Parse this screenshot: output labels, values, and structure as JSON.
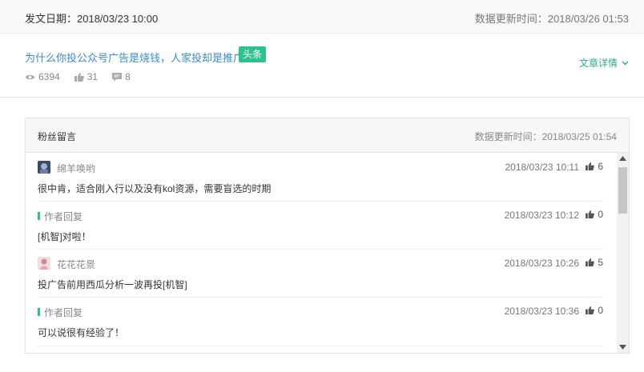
{
  "header": {
    "publish_label": "发文日期：2018/03/23 10:00",
    "update_label": "数据更新时间：2018/03/26 01:53"
  },
  "article": {
    "title": "为什么你投公众号广告是烧钱，人家投却是推广？",
    "badge": "头条",
    "views": "6394",
    "likes": "31",
    "comments": "8",
    "detail_link": "文章详情"
  },
  "comments_panel": {
    "title": "粉丝留言",
    "update_label": "数据更新时间：2018/03/25 01:54",
    "items": [
      {
        "name": "绵羊唤哟",
        "time": "2018/03/23 10:11",
        "likes": "6",
        "text": "很中肯，适合刚入行以及没有kol资源，需要盲选的时期"
      },
      {
        "reply_label": "作者回复",
        "time": "2018/03/23 10:12",
        "likes": "0",
        "text": "[机智]对啦！"
      },
      {
        "name": "花花花景",
        "time": "2018/03/23 10:26",
        "likes": "5",
        "text": "投广告前用西瓜分析一波再投[机智]"
      },
      {
        "reply_label": "作者回复",
        "time": "2018/03/23 10:36",
        "likes": "0",
        "text": "可以说很有经验了！"
      }
    ]
  },
  "icons": {
    "views": "eye-icon",
    "likes": "thumbs-up-icon",
    "comments": "comment-icon",
    "detail": "chevron-down-icon"
  },
  "colors": {
    "accent_green": "#2dc28c",
    "link_blue": "#3a8ad1"
  }
}
